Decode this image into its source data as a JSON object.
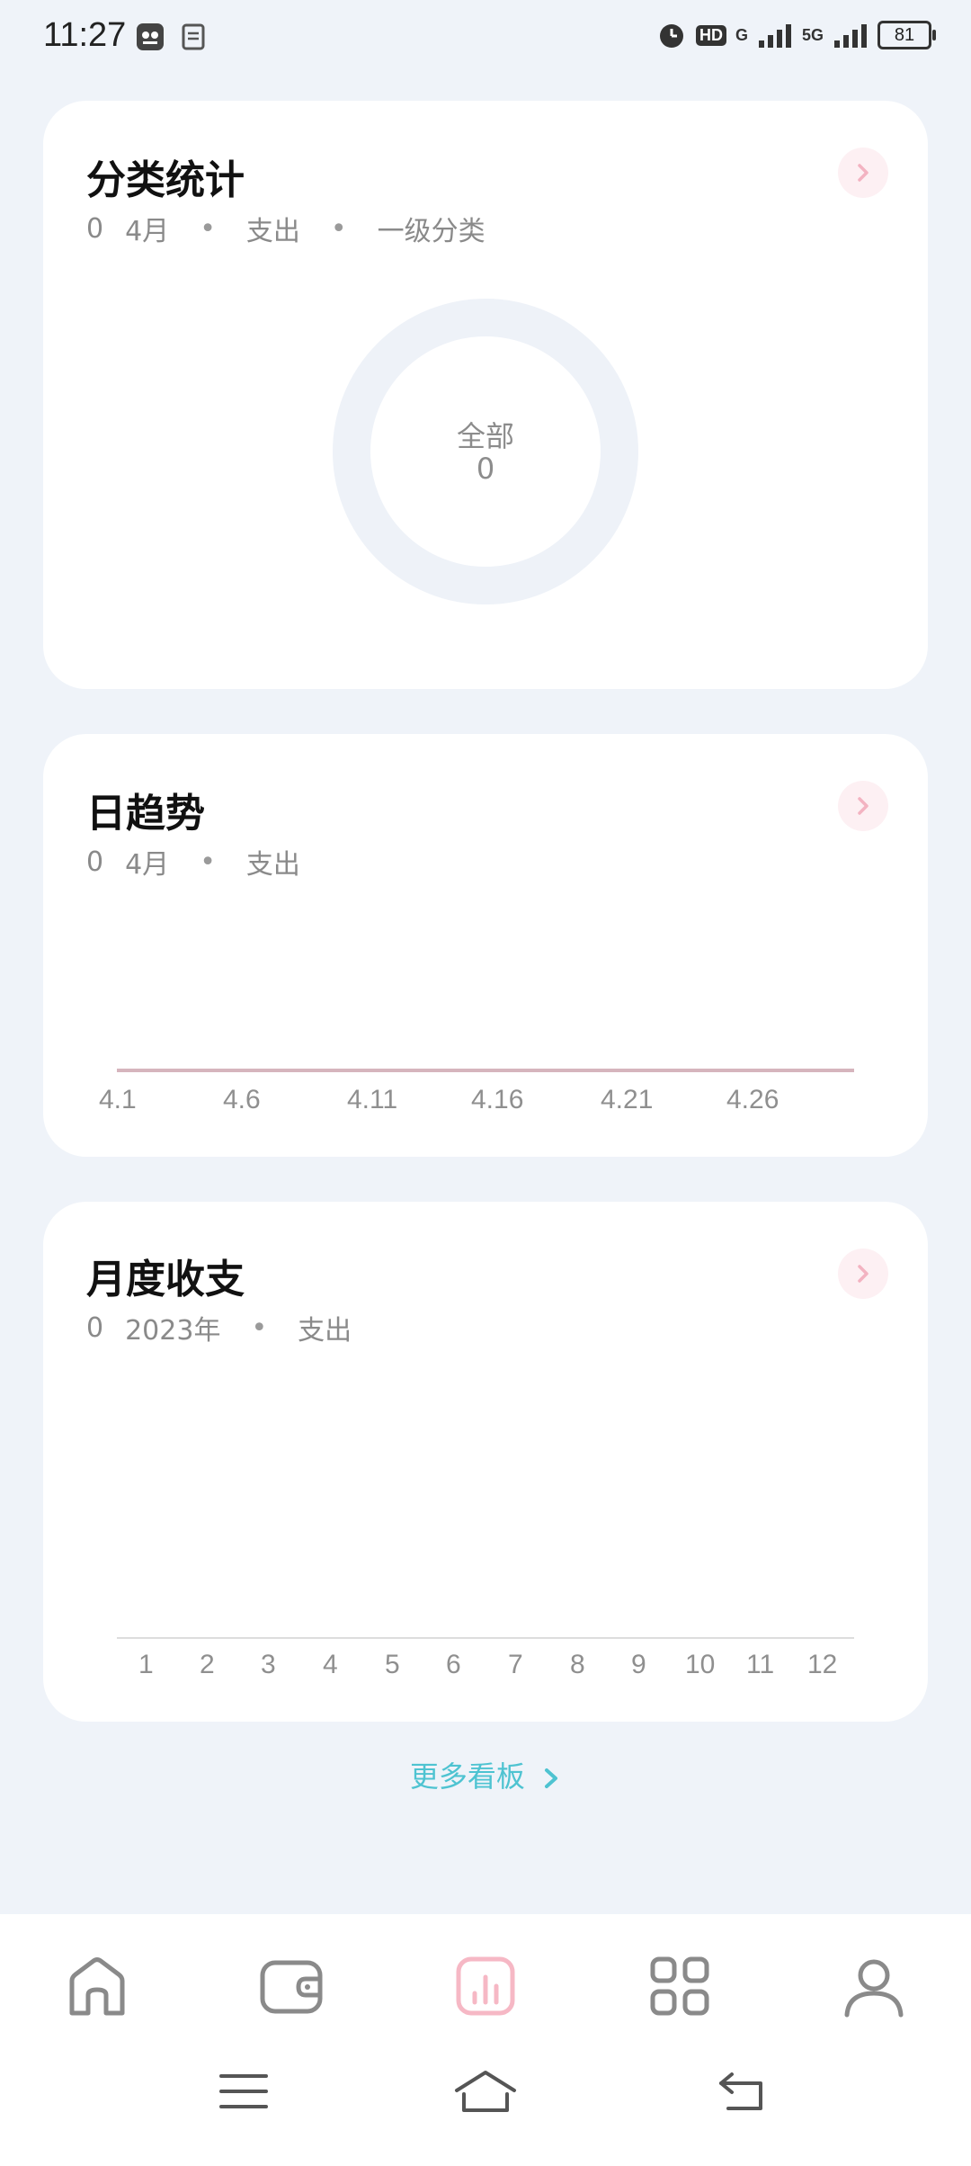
{
  "status": {
    "time": "11:27",
    "battery": "81",
    "hd": "HD",
    "sig1": "G",
    "sig2": "5G"
  },
  "cards": {
    "category": {
      "title": "分类统计",
      "count": "0",
      "month": "4月",
      "type": "支出",
      "level": "一级分类",
      "center_label": "全部",
      "center_value": "0"
    },
    "daily": {
      "title": "日趋势",
      "count": "0",
      "month": "4月",
      "type": "支出",
      "ticks": [
        "4.1",
        "4.6",
        "4.11",
        "4.16",
        "4.21",
        "4.26"
      ]
    },
    "monthly": {
      "title": "月度收支",
      "count": "0",
      "year": "2023年",
      "type": "支出",
      "ticks": [
        "1",
        "2",
        "3",
        "4",
        "5",
        "6",
        "7",
        "8",
        "9",
        "10",
        "11",
        "12"
      ]
    }
  },
  "more_link": "更多看板",
  "nav": {
    "items": [
      "home-icon",
      "wallet-icon",
      "chart-icon",
      "grid-icon",
      "user-icon"
    ],
    "active": "chart-icon"
  },
  "colors": {
    "accent_pink": "#f6b8c5",
    "link_teal": "#4ec3d1",
    "background": "#eff3f9"
  }
}
